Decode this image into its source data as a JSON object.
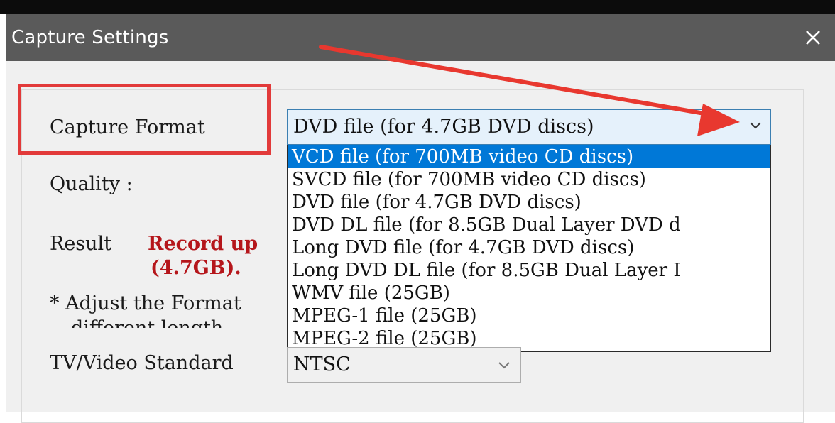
{
  "window": {
    "title": "Capture Settings",
    "close_icon": "close-icon"
  },
  "form": {
    "capture_format_label": "Capture Format",
    "quality_label": "Quality :",
    "result_label": "Result",
    "result_text_line1": "Record up",
    "result_text_line2": "(4.7GB).",
    "note_line1": "* Adjust the Format",
    "note_line2": "different length",
    "tv_standard_label": "TV/Video Standard"
  },
  "capture_format": {
    "selected": "DVD file (for 4.7GB DVD discs)",
    "options": [
      "VCD file (for 700MB video CD discs)",
      "SVCD file (for 700MB video CD discs)",
      "DVD file (for 4.7GB DVD discs)",
      "DVD DL file (for 8.5GB Dual Layer DVD d",
      "Long DVD file (for 4.7GB DVD discs)",
      "Long DVD DL file (for 8.5GB Dual Layer I",
      "WMV file (25GB)",
      "MPEG-1 file (25GB)",
      "MPEG-2 file (25GB)"
    ],
    "highlighted_index": 0
  },
  "tv_standard": {
    "selected": "NTSC"
  },
  "colors": {
    "annotation_red": "#e23a3a",
    "result_red": "#b5161b",
    "selection_blue": "#0078d7",
    "titlebar": "#5a5a5a"
  }
}
